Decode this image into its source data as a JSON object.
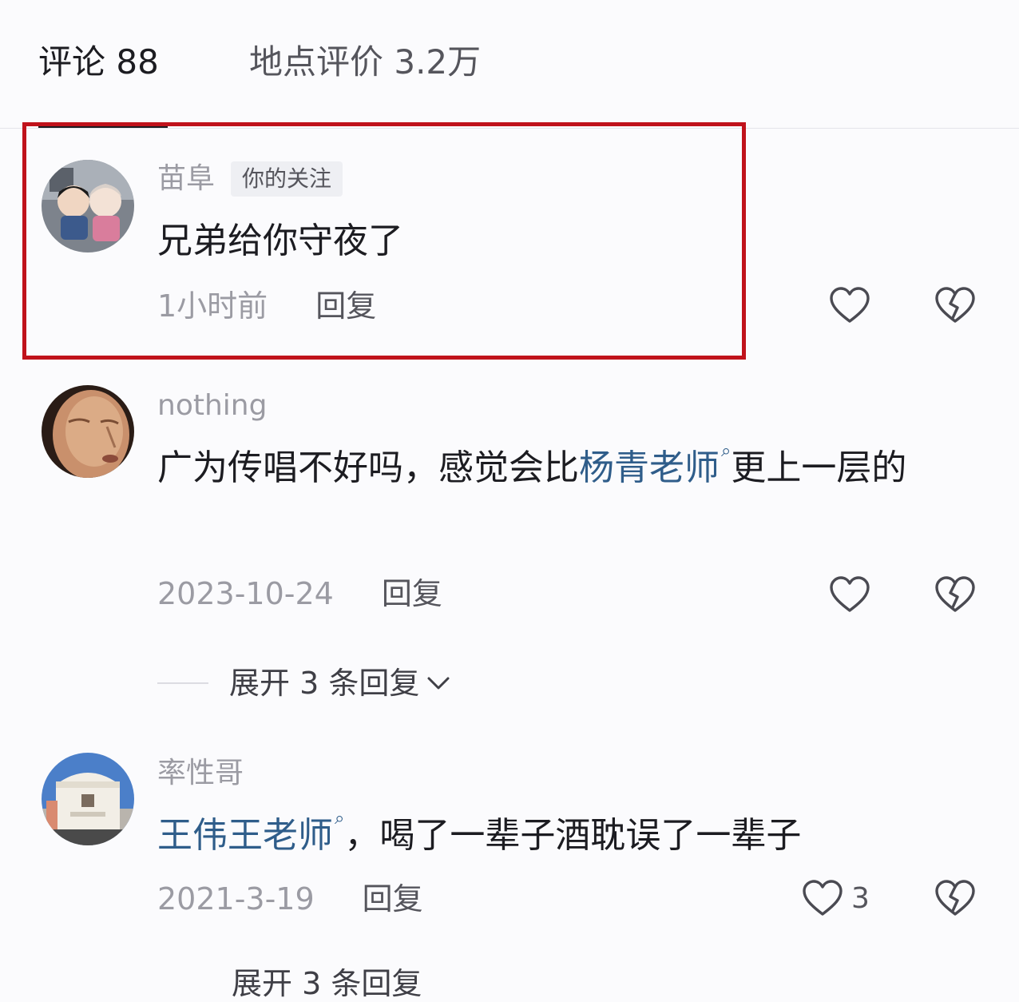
{
  "tabs": {
    "comments_label": "评论 88",
    "place_label": "地点评价 3.2万"
  },
  "comments": [
    {
      "username": "苗阜",
      "tag": "你的关注",
      "text": "兄弟给你守夜了",
      "time": "1小时前",
      "reply_label": "回复",
      "likes": ""
    },
    {
      "username": "nothing",
      "text_before": "广为传唱不好吗，感觉会比",
      "mention": "杨青老师",
      "text_after": "更上一层的",
      "time": "2023-10-24",
      "reply_label": "回复",
      "likes": "",
      "expand_label": "展开 3 条回复"
    },
    {
      "username": "率性哥",
      "mention": "王伟王老师",
      "text_after": "，喝了一辈子酒耽误了一辈子",
      "time": "2021-3-19",
      "reply_label": "回复",
      "likes": "3",
      "expand_label": "展开 3 条回复"
    }
  ],
  "colors": {
    "highlight": "#c0121b",
    "mention": "#2f5d8a",
    "muted": "#9b9ba3"
  },
  "icons": [
    "search-mention-icon",
    "heart-icon",
    "broken-heart-icon",
    "chevron-down-icon"
  ]
}
